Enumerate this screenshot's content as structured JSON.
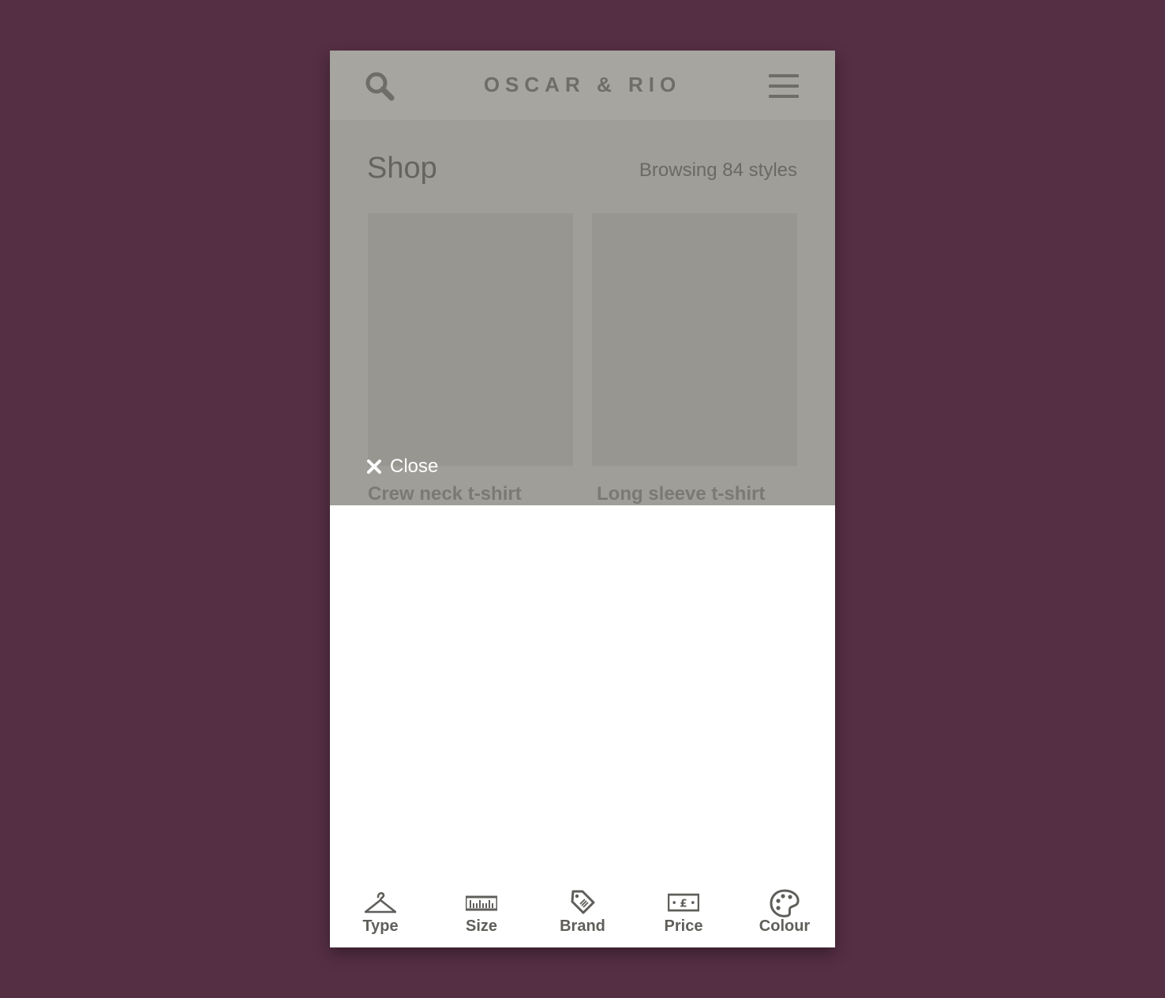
{
  "app": {
    "brand": "OSCAR & RIO"
  },
  "page": {
    "title": "Shop",
    "browse_count": "Browsing 84 styles"
  },
  "products": [
    {
      "name": "Crew neck t-shirt"
    },
    {
      "name": "Long sleeve t-shirt"
    }
  ],
  "overlay": {
    "close_label": "Close"
  },
  "filters": [
    {
      "label": "Type",
      "icon": "hanger-icon"
    },
    {
      "label": "Size",
      "icon": "ruler-icon"
    },
    {
      "label": "Brand",
      "icon": "tag-icon"
    },
    {
      "label": "Price",
      "icon": "banknote-icon"
    },
    {
      "label": "Colour",
      "icon": "palette-icon"
    }
  ],
  "colors": {
    "background": "#552f44",
    "overlay": "#9f9e99",
    "header": "#a6a5a0",
    "icon": "#5f5e5a"
  }
}
